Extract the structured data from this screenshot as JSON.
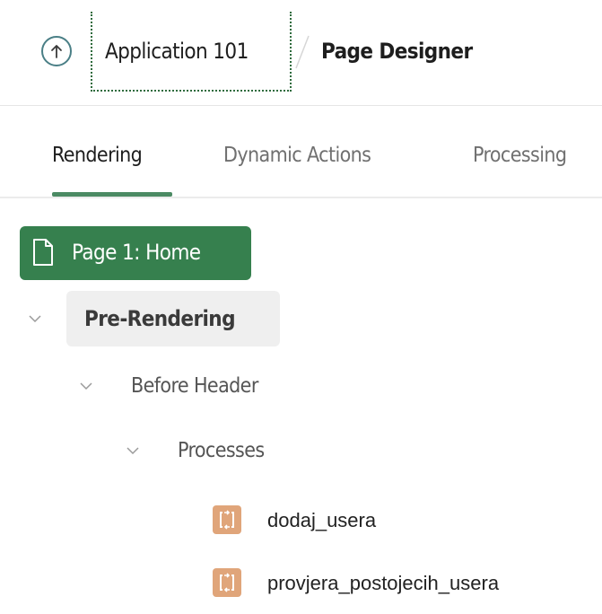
{
  "header": {
    "up_icon": "arrow-up-icon",
    "application_label": "Application 101",
    "page_title": "Page Designer"
  },
  "tabs": [
    {
      "label": "Rendering",
      "active": true
    },
    {
      "label": "Dynamic Actions",
      "active": false
    },
    {
      "label": "Processing",
      "active": false
    }
  ],
  "tree": {
    "page": {
      "label": "Page 1: Home",
      "icon": "page-icon"
    },
    "pre_rendering": {
      "label": "Pre-Rendering"
    },
    "before_header": {
      "label": "Before Header"
    },
    "processes": {
      "label": "Processes"
    },
    "process_items": [
      {
        "label": "dodaj_usera",
        "icon": "process-icon"
      },
      {
        "label": "provjera_postojecih_usera",
        "icon": "process-icon"
      }
    ]
  },
  "colors": {
    "accent_green": "#36804e",
    "tab_underline": "#4b8a63",
    "process_icon_bg": "#e0a57a",
    "up_button_border": "#4a7f86"
  }
}
